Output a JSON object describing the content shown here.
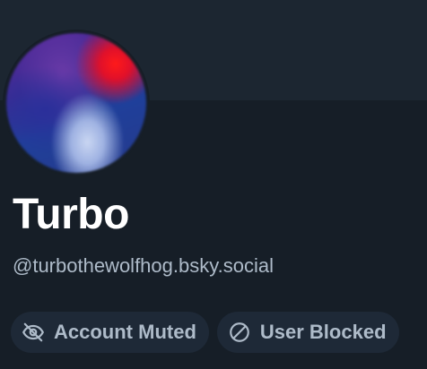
{
  "profile": {
    "display_name": "Turbo",
    "handle": "@turbothewolfhog.bsky.social"
  },
  "labels": [
    {
      "text": "Account Muted",
      "icon": "eye-slash-icon"
    },
    {
      "text": "User Blocked",
      "icon": "block-icon"
    }
  ],
  "colors": {
    "background": "#161e27",
    "banner": "#1c2631",
    "pill_background": "#1e2937",
    "text_primary": "#ffffff",
    "text_secondary": "#aebbc9"
  }
}
